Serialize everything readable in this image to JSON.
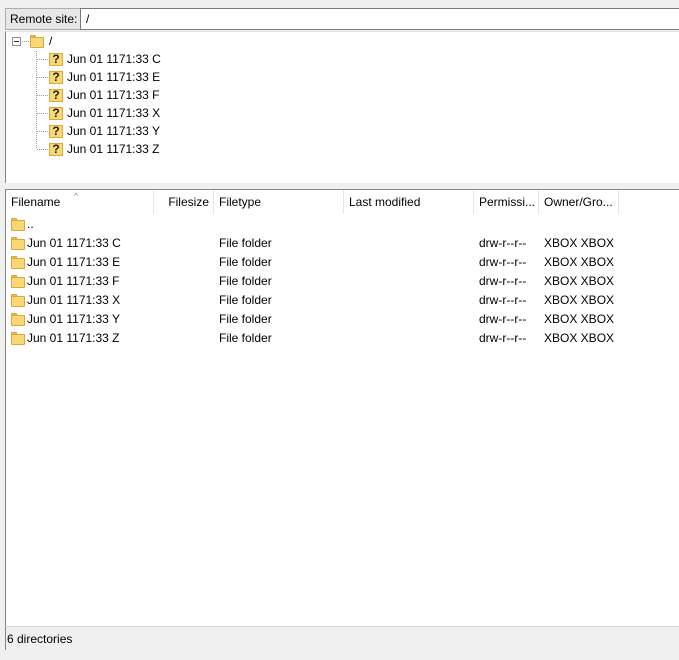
{
  "remote_site": {
    "label": "Remote site:",
    "path": "/"
  },
  "tree": {
    "root_label": "/",
    "items": [
      {
        "label": "Jun 01 1171:33 C",
        "icon": "unknown-folder-icon"
      },
      {
        "label": "Jun 01 1171:33 E",
        "icon": "unknown-folder-icon"
      },
      {
        "label": "Jun 01 1171:33 F",
        "icon": "unknown-folder-icon"
      },
      {
        "label": "Jun 01 1171:33 X",
        "icon": "unknown-folder-icon"
      },
      {
        "label": "Jun 01 1171:33 Y",
        "icon": "unknown-folder-icon"
      },
      {
        "label": "Jun 01 1171:33 Z",
        "icon": "unknown-folder-icon"
      }
    ]
  },
  "list": {
    "columns": {
      "filename": "Filename",
      "filesize": "Filesize",
      "filetype": "Filetype",
      "last_modified": "Last modified",
      "permissions": "Permissi...",
      "owner_group": "Owner/Gro..."
    },
    "parent_entry": "..",
    "rows": [
      {
        "filename": "Jun 01 1171:33 C",
        "filesize": "",
        "filetype": "File folder",
        "last_modified": "",
        "permissions": "drw-r--r--",
        "owner_group": "XBOX XBOX"
      },
      {
        "filename": "Jun 01 1171:33 E",
        "filesize": "",
        "filetype": "File folder",
        "last_modified": "",
        "permissions": "drw-r--r--",
        "owner_group": "XBOX XBOX"
      },
      {
        "filename": "Jun 01 1171:33 F",
        "filesize": "",
        "filetype": "File folder",
        "last_modified": "",
        "permissions": "drw-r--r--",
        "owner_group": "XBOX XBOX"
      },
      {
        "filename": "Jun 01 1171:33 X",
        "filesize": "",
        "filetype": "File folder",
        "last_modified": "",
        "permissions": "drw-r--r--",
        "owner_group": "XBOX XBOX"
      },
      {
        "filename": "Jun 01 1171:33 Y",
        "filesize": "",
        "filetype": "File folder",
        "last_modified": "",
        "permissions": "drw-r--r--",
        "owner_group": "XBOX XBOX"
      },
      {
        "filename": "Jun 01 1171:33 Z",
        "filesize": "",
        "filetype": "File folder",
        "last_modified": "",
        "permissions": "drw-r--r--",
        "owner_group": "XBOX XBOX"
      }
    ]
  },
  "status": {
    "text": "6 directories"
  },
  "colors": {
    "folder": "#f9d776",
    "folder_border": "#d9a93a",
    "pane_border": "#828790",
    "chrome": "#f0f0f0"
  }
}
